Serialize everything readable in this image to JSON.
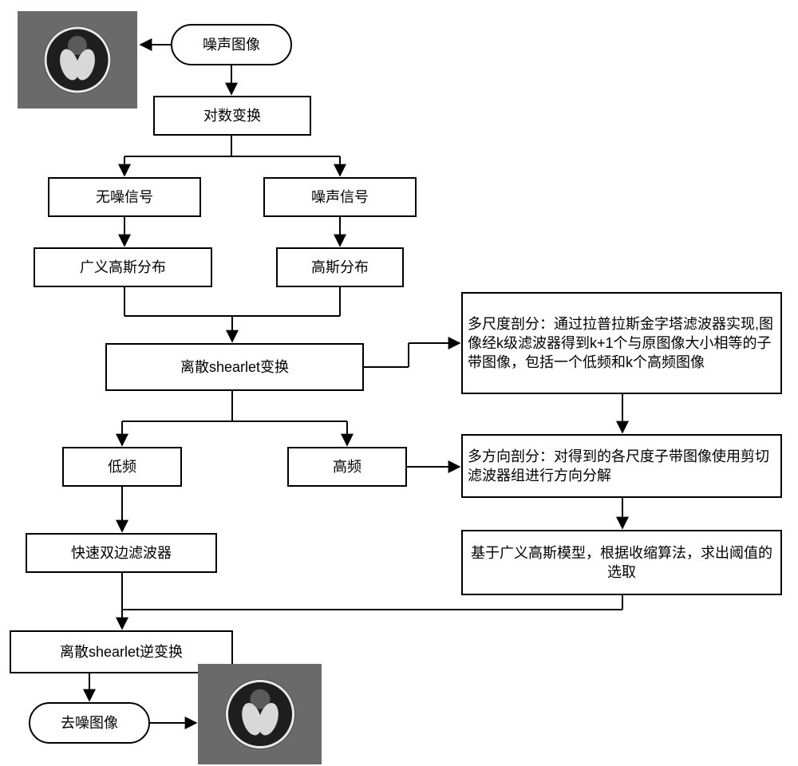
{
  "nodes": {
    "noisy_image": "噪声图像",
    "log_transform": "对数变换",
    "clean_signal": "无噪信号",
    "noise_signal": "噪声信号",
    "ggd": "广义高斯分布",
    "gaussian": "高斯分布",
    "dst": "离散shearlet变换",
    "low_freq": "低频",
    "high_freq": "高频",
    "bilateral": "快速双边滤波器",
    "inverse_dst": "离散shearlet逆变换",
    "denoised_image": "去噪图像",
    "multiscale": "多尺度剖分：通过拉普拉斯金字塔滤波器实现,图像经k级滤波器得到k+1个与原图像大小相等的子带图像，包括一个低频和k个高频图像",
    "multidir": "多方向剖分：对得到的各尺度子带图像使用剪切滤波器组进行方向分解",
    "threshold": "基于广义高斯模型，根据收缩算法，求出阈值的选取"
  }
}
